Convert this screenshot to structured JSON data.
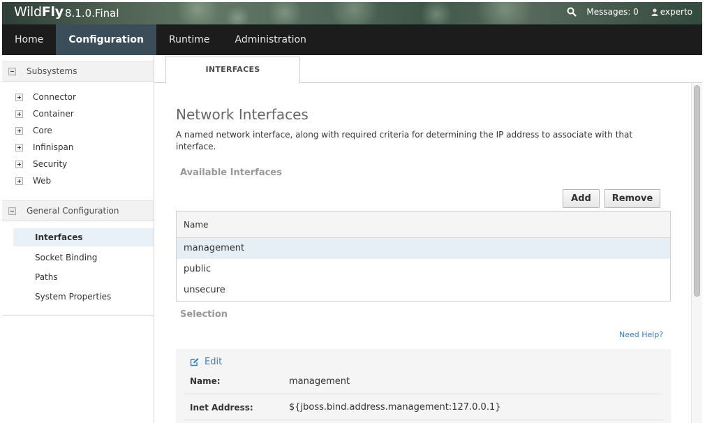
{
  "header": {
    "brand_wild": "Wild",
    "brand_fly": "Fly",
    "version": "8.1.0.Final",
    "messages_label": "Messages: 0",
    "username": "experto",
    "search_icon": "search-icon",
    "user_icon": "user-icon"
  },
  "nav": {
    "items": [
      {
        "label": "Home",
        "active": false
      },
      {
        "label": "Configuration",
        "active": true
      },
      {
        "label": "Runtime",
        "active": false
      },
      {
        "label": "Administration",
        "active": false
      }
    ]
  },
  "sidebar": {
    "subsystems_header": "Subsystems",
    "subsystems": [
      "Connector",
      "Container",
      "Core",
      "Infinispan",
      "Security",
      "Web"
    ],
    "general_header": "General Configuration",
    "general_items": [
      {
        "label": "Interfaces",
        "active": true
      },
      {
        "label": "Socket Binding",
        "active": false
      },
      {
        "label": "Paths",
        "active": false
      },
      {
        "label": "System Properties",
        "active": false
      }
    ]
  },
  "content": {
    "tab_label": "INTERFACES",
    "title": "Network Interfaces",
    "description": "A named network interface, along with required criteria for determining the IP address to associate with that interface.",
    "available_header": "Available Interfaces",
    "add_label": "Add",
    "remove_label": "Remove",
    "table": {
      "column": "Name",
      "rows": [
        "management",
        "public",
        "unsecure"
      ],
      "selected_index": 0
    },
    "selection_header": "Selection",
    "help_link": "Need Help?",
    "detail": {
      "edit_label": "Edit",
      "name_label": "Name:",
      "name_value": "management",
      "inet_label": "Inet Address:",
      "inet_value": "${jboss.bind.address.management:127.0.0.1}"
    }
  },
  "colors": {
    "nav_bg": "#1c1c1c",
    "nav_active_bg": "#3b4d59",
    "link": "#3d7cb3",
    "selected_row": "#e6eff6"
  }
}
